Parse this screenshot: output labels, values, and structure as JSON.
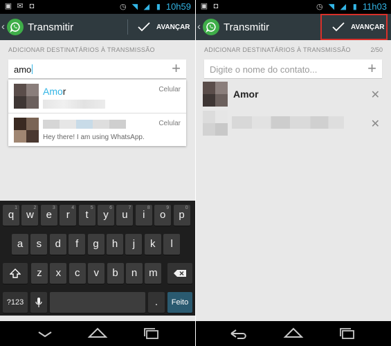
{
  "left": {
    "status_time": "10h59",
    "action_title": "Transmitir",
    "action_label": "AVANÇAR",
    "section_label": "ADICIONAR DESTINATÁRIOS À TRANSMISSÃO",
    "search_value": "amo",
    "results": [
      {
        "name_highlight": "Amo",
        "name_rest": "r",
        "tag": "Celular",
        "status": ""
      },
      {
        "name_highlight": "",
        "name_rest": "",
        "tag": "Celular",
        "status": "Hey there! I am using WhatsApp."
      }
    ],
    "keyboard": {
      "row1": [
        {
          "k": "q",
          "d": "1"
        },
        {
          "k": "w",
          "d": "2"
        },
        {
          "k": "e",
          "d": "3"
        },
        {
          "k": "r",
          "d": "4"
        },
        {
          "k": "t",
          "d": "5"
        },
        {
          "k": "y",
          "d": "6"
        },
        {
          "k": "u",
          "d": "7"
        },
        {
          "k": "i",
          "d": "8"
        },
        {
          "k": "o",
          "d": "9"
        },
        {
          "k": "p",
          "d": "0"
        }
      ],
      "row2": [
        "a",
        "s",
        "d",
        "f",
        "g",
        "h",
        "j",
        "k",
        "l"
      ],
      "row3": [
        "z",
        "x",
        "c",
        "v",
        "b",
        "n",
        "m"
      ],
      "sym_label": "?123",
      "period_label": ".",
      "go_label": "Feito"
    }
  },
  "right": {
    "status_time": "11h03",
    "action_title": "Transmitir",
    "action_label": "AVANÇAR",
    "section_label": "ADICIONAR DESTINATÁRIOS À TRANSMISSÃO",
    "count": "2/50",
    "search_placeholder": "Digite o nome do contato...",
    "recipients": [
      {
        "name": "Amor"
      },
      {
        "name": ""
      }
    ]
  },
  "icons": {
    "back": "chevron-left-icon",
    "logo": "whatsapp-icon",
    "check": "checkmark-icon",
    "plus": "plus-icon",
    "remove": "close-icon",
    "shift": "shift-icon",
    "backspace": "backspace-icon",
    "mic": "microphone-icon",
    "nav_back": "back-icon",
    "nav_home": "home-icon",
    "nav_recent": "recent-apps-icon"
  },
  "colors": {
    "accent": "#33b5e5",
    "action_bar": "#2f3a3f",
    "whatsapp_green": "#3fae49",
    "highlight_border": "#d9302a"
  }
}
